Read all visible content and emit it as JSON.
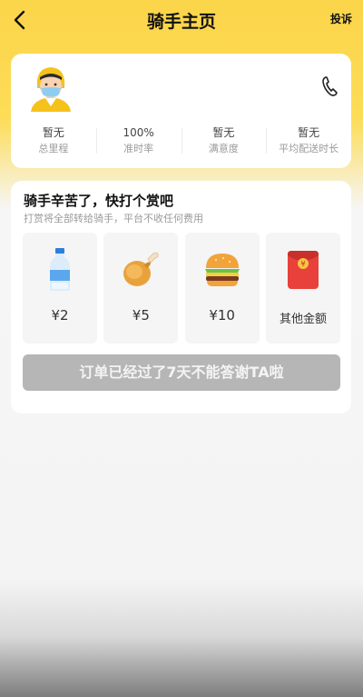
{
  "header": {
    "title": "骑手主页",
    "complain_label": "投诉",
    "back_icon": "chevron-left-icon"
  },
  "rider": {
    "avatar_icon": "rider-avatar",
    "phone_icon": "phone-icon",
    "stats": [
      {
        "value": "暂无",
        "label": "总里程"
      },
      {
        "value": "100%",
        "label": "准时率"
      },
      {
        "value": "暂无",
        "label": "满意度"
      },
      {
        "value": "暂无",
        "label": "平均配送时长"
      }
    ]
  },
  "tip": {
    "title": "骑手辛苦了，快打个赏吧",
    "subtitle": "打赏将全部转给骑手，平台不收任何费用",
    "options": [
      {
        "icon": "water-bottle-icon",
        "label": "¥2"
      },
      {
        "icon": "chicken-leg-icon",
        "label": "¥5"
      },
      {
        "icon": "burger-icon",
        "label": "¥10"
      },
      {
        "icon": "red-envelope-icon",
        "label": "其他金额"
      }
    ],
    "disabled_button": "订单已经过了7天不能答谢TA啦"
  },
  "colors": {
    "brand_yellow": "#fbd54a",
    "disabled_gray": "#b6b6b6",
    "red_envelope": "#e8413b"
  }
}
